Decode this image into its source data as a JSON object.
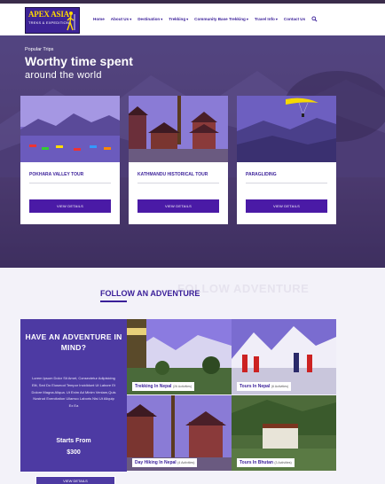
{
  "header": {
    "logo": {
      "line1": "APEX ASIA",
      "line2": "TREKS & EXPEDITION"
    },
    "nav": [
      {
        "label": "Home",
        "caret": ""
      },
      {
        "label": "About Us",
        "caret": "▾"
      },
      {
        "label": "Destination",
        "caret": "▾"
      },
      {
        "label": "Trekking",
        "caret": "▾"
      },
      {
        "label": "Community Base Trekking",
        "caret": "▾"
      },
      {
        "label": "Travel Info",
        "caret": "▾"
      },
      {
        "label": "Contact Us",
        "caret": ""
      }
    ],
    "search_icon": "search-icon"
  },
  "hero": {
    "kicker": "Popular Trips",
    "title": "Worthy time spent",
    "subtitle": "around the world",
    "cards": [
      {
        "title": "POKHARA VALLEY TOUR",
        "button": "VIEW DETAILS"
      },
      {
        "title": "KATHMANDU HISTORICAL TOUR",
        "button": "VIEW DETAILS"
      },
      {
        "title": "PARAGLIDING",
        "button": "VIEW DETAILS"
      }
    ]
  },
  "follow": {
    "ghost": "FOLLOW ADVENTURE",
    "heading": "FOLLOW AN ADVENTURE"
  },
  "promo": {
    "question": "HAVE AN ADVENTURE IN MIND?",
    "lorem": "Lorem Ipsum Dolor Sit Amet, Consectetur Adipisicing Elit, Sed Do Eiusmod Tempor Incididunt Ut Labore Et Dolore Magna Aliqua. Ut Enim Ad Minim Veniam,Quis Nostrud Exercitation Ullamco Laboris Nisi Ut Aliquip Ex Ea",
    "starts_from": "Starts From",
    "price": "$300",
    "button": "VIEW DETAILS"
  },
  "tiles": [
    {
      "name": "Trekking In Nepal",
      "count": "(26 Activities)"
    },
    {
      "name": "Tours In Nepal",
      "count": "(6 Activities)"
    },
    {
      "name": "Day Hiking In Nepal",
      "count": "(4 Activities)"
    },
    {
      "name": "Tours In Bhutan",
      "count": "(3 Activities)"
    }
  ],
  "colors": {
    "brand": "#3a1f99",
    "button": "#4a1aa6",
    "promo": "#4d3aa3"
  }
}
